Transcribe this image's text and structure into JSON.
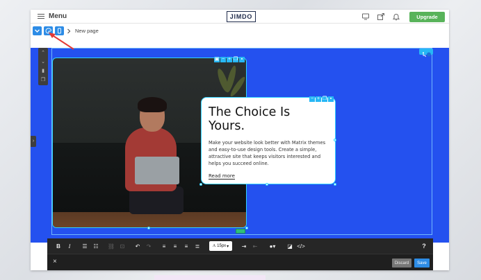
{
  "topbar": {
    "menu_label": "Menu",
    "logo": "JIMDO",
    "upgrade_label": "Upgrade",
    "icons": [
      "monitor-icon",
      "share-icon",
      "bell-icon"
    ]
  },
  "page_bar": {
    "breadcrumb_label": "New page",
    "tools": [
      "chevron-down-icon",
      "palette-icon",
      "mobile-icon"
    ]
  },
  "card": {
    "title": "The Choice Is Yours.",
    "body": "Make your website look better with Matrix themes and easy-to-use design tools. Create a simple, attractive site that keeps visitors interested and helps you succeed online.",
    "link": "Read more"
  },
  "editor": {
    "bold": "B",
    "italic": "I",
    "font_size": "15px",
    "help": "?",
    "close": "×",
    "discard_label": "Discard",
    "save_label": "Save"
  },
  "colors": {
    "section_bg": "#2451ef",
    "accent": "#2d8ce6",
    "upgrade": "#58b35a",
    "selection": "#2fd2ff",
    "annotation_arrow": "#e53935"
  }
}
